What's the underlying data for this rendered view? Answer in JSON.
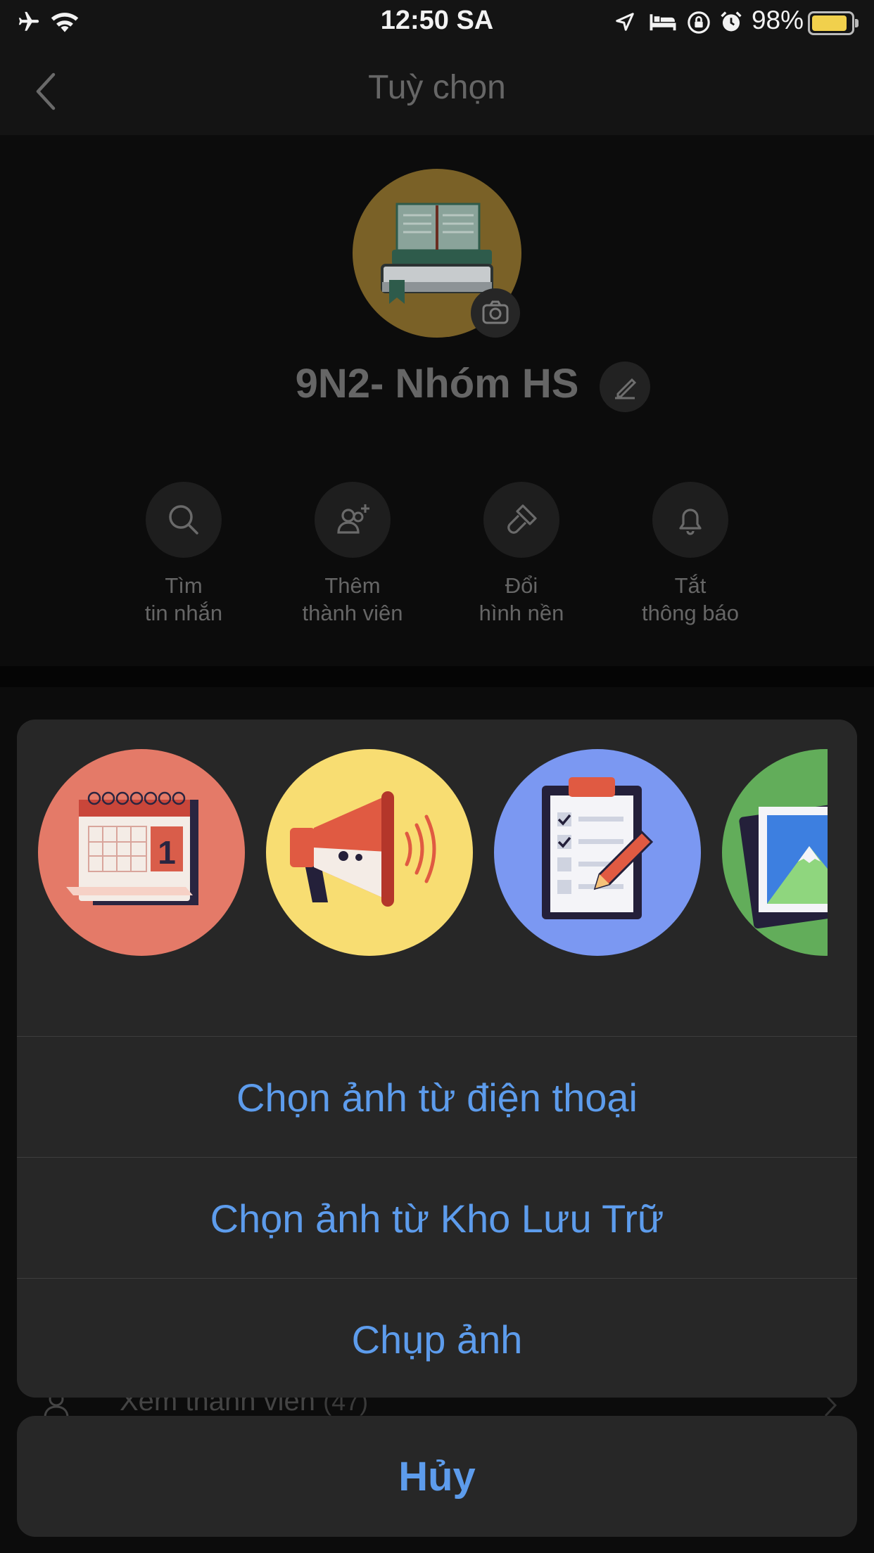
{
  "status_bar": {
    "time": "12:50 SA",
    "battery_percent": "98%"
  },
  "header": {
    "title": "Tuỳ chọn"
  },
  "profile": {
    "group_name": "9N2- Nhóm HS"
  },
  "actions": [
    {
      "line1": "Tìm",
      "line2": "tin nhắn"
    },
    {
      "line1": "Thêm",
      "line2": "thành viên"
    },
    {
      "line1": "Đổi",
      "line2": "hình nền"
    },
    {
      "line1": "Tắt",
      "line2": "thông báo"
    }
  ],
  "background_list": {
    "members_label": "Xem thành viên",
    "members_count": "(47)"
  },
  "sheet": {
    "options": [
      "Chọn ảnh từ điện thoại",
      "Chọn ảnh từ Kho Lưu Trữ",
      "Chụp ảnh"
    ],
    "calendar_day": "1",
    "cancel": "Hủy"
  },
  "colors": {
    "accent": "#5d9cec",
    "sheet_bg": "#272727",
    "battery": "#f1d04c"
  }
}
